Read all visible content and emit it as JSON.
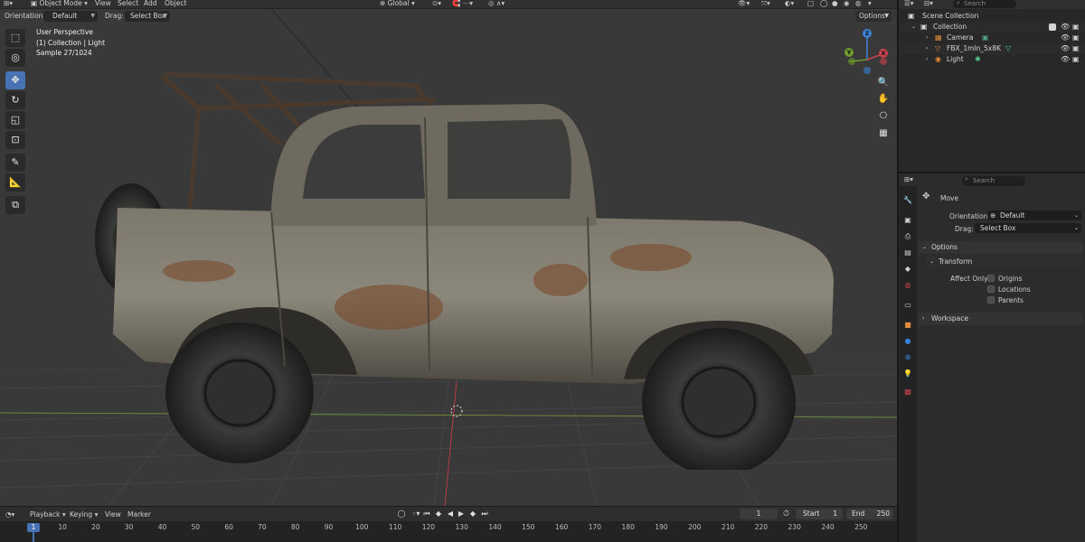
{
  "top_header": {
    "mode": "Object Mode",
    "menus": [
      "View",
      "Select",
      "Add",
      "Object"
    ],
    "transform_orientation": "Global",
    "search_placeholder": "Search"
  },
  "viewport_header": {
    "orientation_label": "Orientation:",
    "orientation_value": "Default",
    "drag_label": "Drag:",
    "drag_value": "Select Box",
    "options_label": "Options"
  },
  "overlay": {
    "perspective": "User Perspective",
    "collection": "(1) Collection | Light",
    "sample": "Sample 27/1024"
  },
  "gizmo": {
    "z": "Z",
    "y": "Y",
    "x": "X"
  },
  "tools": [
    "select-box",
    "cursor",
    "move",
    "rotate",
    "scale",
    "transform",
    "annotate",
    "measure",
    "add-cube"
  ],
  "outliner": {
    "scene_collection": "Scene Collection",
    "collection": "Collection",
    "items": [
      "Camera",
      "FBX_1mln_5x8K",
      "Light"
    ]
  },
  "properties": {
    "search_placeholder": "Search",
    "tool_name": "Move",
    "orientation_label": "Orientation",
    "orientation_value": "Default",
    "drag_label": "Drag:",
    "drag_value": "Select Box",
    "options_panel": "Options",
    "transform_panel": "Transform",
    "affect_only_label": "Affect Only",
    "affect_options": [
      "Origins",
      "Locations",
      "Parents"
    ],
    "workspace_panel": "Workspace"
  },
  "timeline": {
    "menus": [
      "Playback",
      "Keying",
      "View",
      "Marker"
    ],
    "current_frame": "1",
    "start_label": "Start",
    "start_value": "1",
    "end_label": "End",
    "end_value": "250",
    "ruler_ticks": [
      "1",
      "10",
      "20",
      "30",
      "40",
      "50",
      "60",
      "70",
      "80",
      "90",
      "100",
      "110",
      "120",
      "130",
      "140",
      "150",
      "160",
      "170",
      "180",
      "190",
      "200",
      "210",
      "220",
      "230",
      "240",
      "250"
    ],
    "playhead_frame": "1"
  },
  "colors": {
    "accent": "#4772b3",
    "x_axis": "#c9414b",
    "y_axis": "#6c9b2d",
    "z_axis": "#3a82d8"
  }
}
